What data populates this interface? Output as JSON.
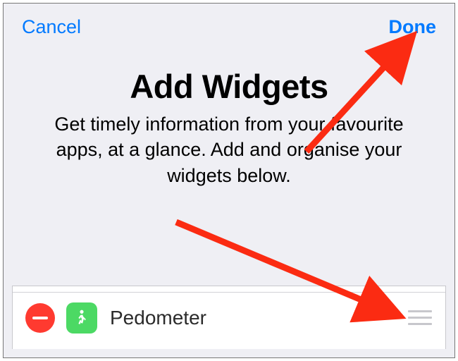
{
  "nav": {
    "cancel": "Cancel",
    "done": "Done"
  },
  "header": {
    "title": "Add Widgets",
    "subtitle": "Get timely information from your favourite apps, at a glance. Add and organise your widgets below."
  },
  "list": {
    "items": [
      {
        "name": "Pedometer",
        "icon": "walker-icon"
      }
    ]
  },
  "colors": {
    "accent": "#027aff",
    "remove": "#ff3a30",
    "app_icon": "#4cd964",
    "bg": "#efeff4"
  }
}
